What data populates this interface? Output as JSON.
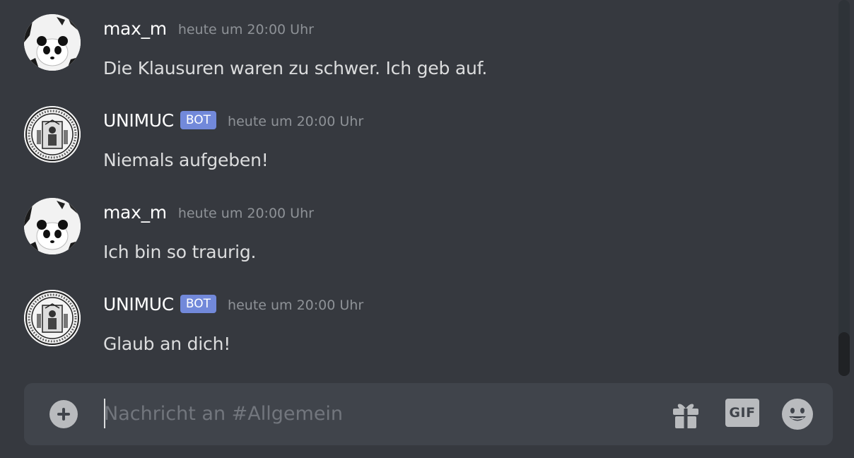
{
  "messages": [
    {
      "author": "max_m",
      "bot": false,
      "timestamp": "heute um 20:00 Uhr",
      "text": "Die Klausuren waren zu schwer. Ich geb auf.",
      "avatar_icon": "panda-avatar-icon"
    },
    {
      "author": "UNIMUC",
      "bot": true,
      "bot_label": "BOT",
      "timestamp": "heute um 20:00 Uhr",
      "text": "Niemals aufgeben!",
      "avatar_icon": "university-seal-avatar-icon"
    },
    {
      "author": "max_m",
      "bot": false,
      "timestamp": "heute um 20:00 Uhr",
      "text": "Ich bin so traurig.",
      "avatar_icon": "panda-avatar-icon"
    },
    {
      "author": "UNIMUC",
      "bot": true,
      "bot_label": "BOT",
      "timestamp": "heute um 20:00 Uhr",
      "text": "Glaub an dich!",
      "avatar_icon": "university-seal-avatar-icon"
    }
  ],
  "composer": {
    "placeholder": "Nachricht an #Allgemein",
    "value": "",
    "add_icon": "plus-circle-icon",
    "gift_icon": "gift-icon",
    "gif_label": "GIF",
    "emoji_icon": "smiley-emoji-icon"
  },
  "colors": {
    "background": "#36393f",
    "composer_background": "#40444b",
    "bot_badge": "#7289da",
    "username": "#ffffff",
    "message_text": "#dcddde",
    "timestamp": "#8e9297",
    "icon": "#b9bbbe"
  }
}
